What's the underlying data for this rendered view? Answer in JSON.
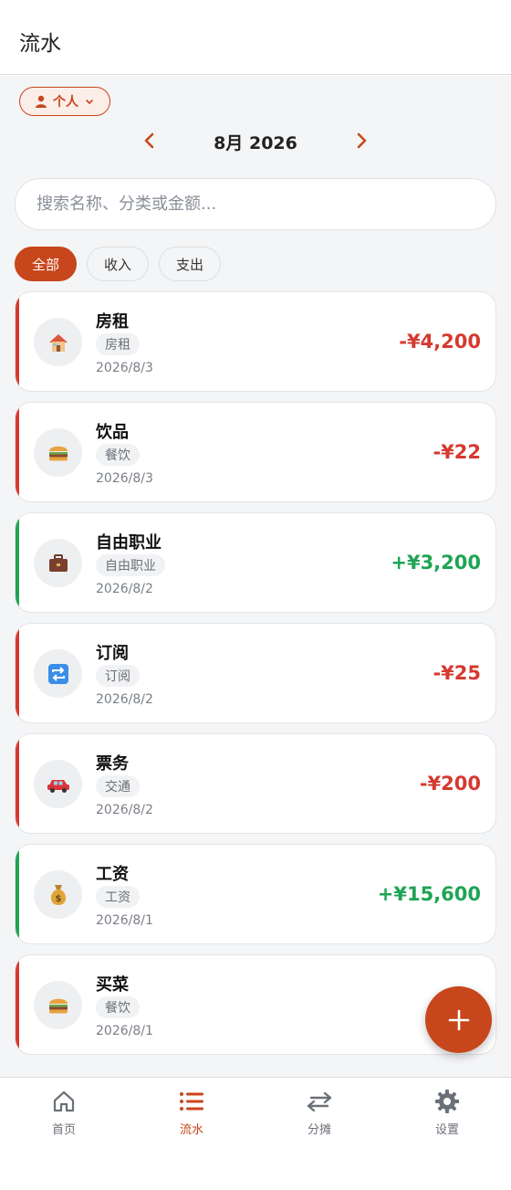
{
  "header": {
    "title": "流水"
  },
  "scope": {
    "label": "个人",
    "icon": "person-icon"
  },
  "month_nav": {
    "label": "8月 2026"
  },
  "search": {
    "placeholder": "搜索名称、分类或金额..."
  },
  "filters": [
    {
      "label": "全部",
      "active": true
    },
    {
      "label": "收入",
      "active": false
    },
    {
      "label": "支出",
      "active": false
    }
  ],
  "colors": {
    "accent": "#c8461b",
    "expense": "#d6392f",
    "income": "#1fa454"
  },
  "transactions": [
    {
      "name": "房租",
      "category": "房租",
      "date": "2026/8/3",
      "amount": "-¥4,200",
      "type": "expense",
      "icon": "house-icon"
    },
    {
      "name": "饮品",
      "category": "餐饮",
      "date": "2026/8/3",
      "amount": "-¥22",
      "type": "expense",
      "icon": "burger-icon"
    },
    {
      "name": "自由职业",
      "category": "自由职业",
      "date": "2026/8/2",
      "amount": "+¥3,200",
      "type": "income",
      "icon": "briefcase-icon"
    },
    {
      "name": "订阅",
      "category": "订阅",
      "date": "2026/8/2",
      "amount": "-¥25",
      "type": "expense",
      "icon": "repeat-icon"
    },
    {
      "name": "票务",
      "category": "交通",
      "date": "2026/8/2",
      "amount": "-¥200",
      "type": "expense",
      "icon": "car-icon"
    },
    {
      "name": "工资",
      "category": "工资",
      "date": "2026/8/1",
      "amount": "+¥15,600",
      "type": "income",
      "icon": "money-bag-icon"
    },
    {
      "name": "买菜",
      "category": "餐饮",
      "date": "2026/8/1",
      "amount": "-¥…",
      "type": "expense",
      "icon": "burger-icon"
    }
  ],
  "bottom_nav": [
    {
      "label": "首页",
      "icon": "home-icon",
      "active": false
    },
    {
      "label": "流水",
      "icon": "list-icon",
      "active": true
    },
    {
      "label": "分摊",
      "icon": "split-arrows-icon",
      "active": false
    },
    {
      "label": "设置",
      "icon": "gear-icon",
      "active": false
    }
  ]
}
